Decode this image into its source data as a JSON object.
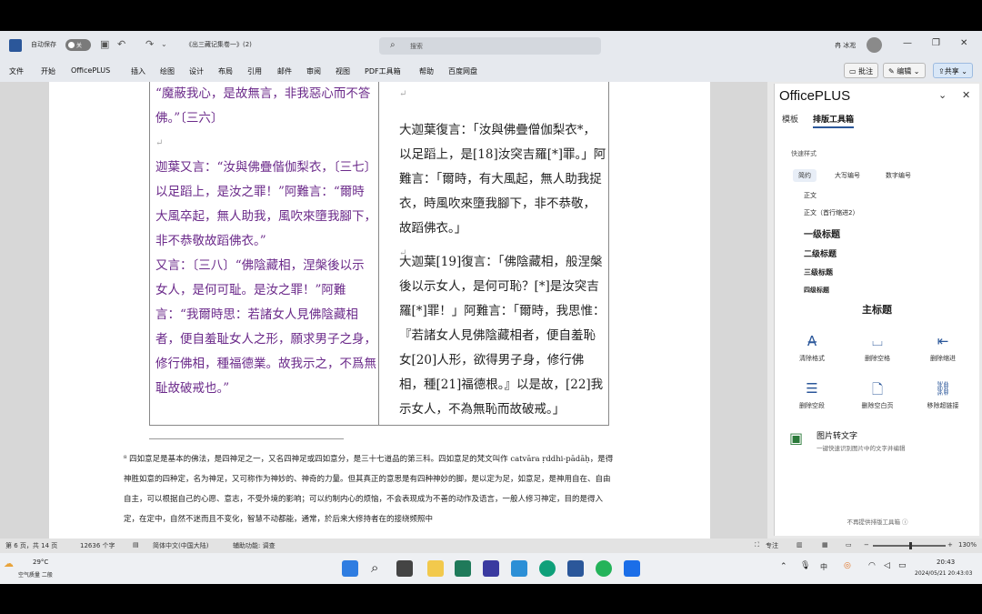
{
  "titlebar": {
    "autosave_label": "自动保存",
    "autosave_state": "关",
    "doc_title": "《出三藏记集卷一》(2)",
    "search_placeholder": "搜索",
    "user_name": "冉 冰凇"
  },
  "menu": {
    "items": [
      "文件",
      "开始",
      "OfficePLUS",
      "插入",
      "绘图",
      "设计",
      "布局",
      "引用",
      "邮件",
      "审阅",
      "视图",
      "PDF工具箱",
      "帮助",
      "百度网盘"
    ],
    "comment_label": "批注",
    "edit_label": "编辑",
    "share_label": "共享"
  },
  "doc": {
    "left_col": [
      "“魔蔽我心，是故無言，非我惡心而不答佛。”〔三六〕",
      "迦葉又言：“汝與佛疊偕伽梨衣，〔三七〕以足蹈上，是汝之罪！”阿難言：“爾時大風卒起，無人助我，風吹來墮我腳下，非不恭敬故蹈佛衣。”",
      "又言：〔三八〕“佛陰藏相，涅槃後以示女人，是何可耻。是汝之罪！”阿難言：“我爾時思：若諸女人見佛陰藏相者，便自羞耻女人之形，願求男子之身，修行佛相，種福德業。故我示之，不爲無耻故破戒也。”"
    ],
    "right_col": [
      "大迦葉復言：「汝與佛疊僧伽梨衣*，以足蹈上，是[18]汝突吉羅[*]罪。」阿難言：「爾時，有大風起，無人助我捉衣，時風吹來墮我腳下，非不恭敬，故蹈佛衣。」",
      "大迦葉[19]復言：「佛陰藏相，般涅槃後以示女人，是何可恥？[*]是汝突吉羅[*]罪！」阿難言：「爾時，我思惟：『若諸女人見佛陰藏相者，便自羞恥女[20]人形，欲得男子身，修行佛相，種[21]福德根。』以是故，[22]我示女人，不為無恥而故破戒。」"
    ],
    "footnote": "⁸ 四如意足是基本的佛法，是四神足之一，又名四神足或四如意分，是三十七道品的第三科。四如意足的梵文叫作 catvāra ṛddhi-pādāḥ，是得神胜如意的四种定，名为神足，又可称作为神妙的、神奇的力量。但其真正的意思是有四种神妙的脚，是以定为足，如意足，是神用自在、自由自主，可以根据自己的心愿、意志，不受外境的影响；可以约制内心的烦恼，不会表现成为不善的动作及语言，一般人修习神定，目的是得入定，在定中，自然不迷而且不变化，智慧不动都能，通常，於后来大修持者在的接绕频照中"
  },
  "panel": {
    "title": "OfficePLUS",
    "tabs": [
      "模板",
      "排版工具箱"
    ],
    "quick_style_label": "快速样式",
    "style_buttons": [
      "简约",
      "大写编号",
      "数字编号"
    ],
    "styles": [
      "正文",
      "正文（首行缩进2）",
      "一级标题",
      "二级标题",
      "三级标题",
      "四级标题"
    ],
    "main_title": "主标题",
    "tools": [
      "清除格式",
      "删除空格",
      "删除缩进",
      "删除空段",
      "删除空白页",
      "移除超链接"
    ],
    "ocr_title": "图片转文字",
    "ocr_desc": "一键快速识别图片中的文字并编辑",
    "footer": "不再提供排版工具箱 ⓘ"
  },
  "status": {
    "page": "第 6 页，共 14 页",
    "words": "12636 个字",
    "language": "简体中文(中国大陆)",
    "accessibility": "辅助功能: 调查",
    "focus": "专注",
    "zoom": "130%"
  },
  "taskbar": {
    "weather_temp": "29°C",
    "weather_desc": "空气质量 二般",
    "time": "20:43",
    "date": "2024/05/21 20:43:03"
  }
}
